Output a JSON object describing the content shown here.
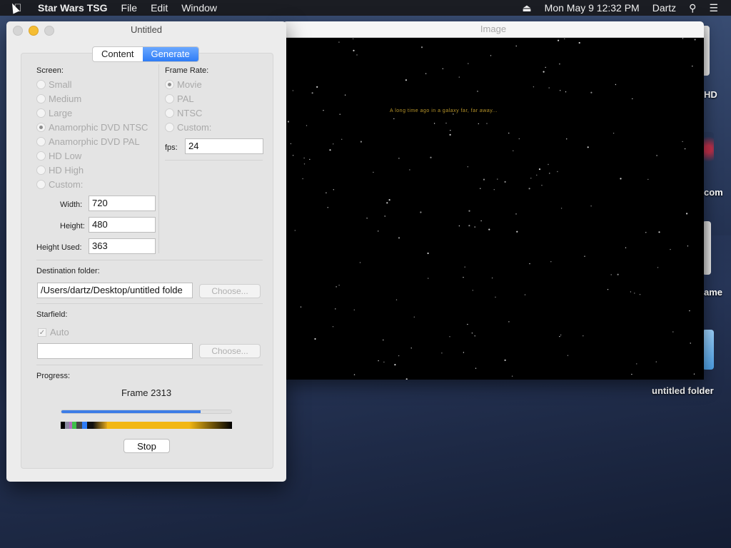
{
  "menubar": {
    "app_name": "Star Wars TSG",
    "menus": [
      "File",
      "Edit",
      "Window"
    ],
    "datetime": "Mon May 9  12:32 PM",
    "user": "Dartz",
    "icons": [
      "apple-icon",
      "eject-icon",
      "search-icon",
      "list-icon"
    ]
  },
  "image_window": {
    "title": "Image",
    "crawl_text": "A long time ago in a galaxy far, far away..."
  },
  "desktop": {
    "icon_labels": [
      "HD",
      "com",
      "ame",
      "untitled folder"
    ]
  },
  "panel": {
    "title": "Untitled",
    "tabs": [
      {
        "label": "Content",
        "active": false
      },
      {
        "label": "Generate",
        "active": true
      }
    ],
    "screen": {
      "label": "Screen:",
      "options": [
        "Small",
        "Medium",
        "Large",
        "Anamorphic DVD NTSC",
        "Anamorphic DVD PAL",
        "HD Low",
        "HD High",
        "Custom:"
      ],
      "selected": "Anamorphic DVD NTSC",
      "width_label": "Width:",
      "width_value": "720",
      "height_label": "Height:",
      "height_value": "480",
      "height_used_label": "Height Used:",
      "height_used_value": "363"
    },
    "frame_rate": {
      "label": "Frame Rate:",
      "options": [
        "Movie",
        "PAL",
        "NTSC",
        "Custom:"
      ],
      "selected": "Movie",
      "fps_label": "fps:",
      "fps_value": "24"
    },
    "destination": {
      "label": "Destination folder:",
      "path": "/Users/dartz/Desktop/untitled folde",
      "choose_label": "Choose..."
    },
    "starfield": {
      "label": "Starfield:",
      "auto_label": "Auto",
      "auto_checked": true,
      "path": "",
      "choose_label": "Choose..."
    },
    "progress": {
      "label": "Progress:",
      "frame_text": "Frame 2313",
      "fraction": 0.82,
      "stop_label": "Stop"
    }
  },
  "colors": {
    "accent": "#2e7cf6",
    "progress_fill": "#3d7de6",
    "crawl_yellow": "#b8952a"
  }
}
